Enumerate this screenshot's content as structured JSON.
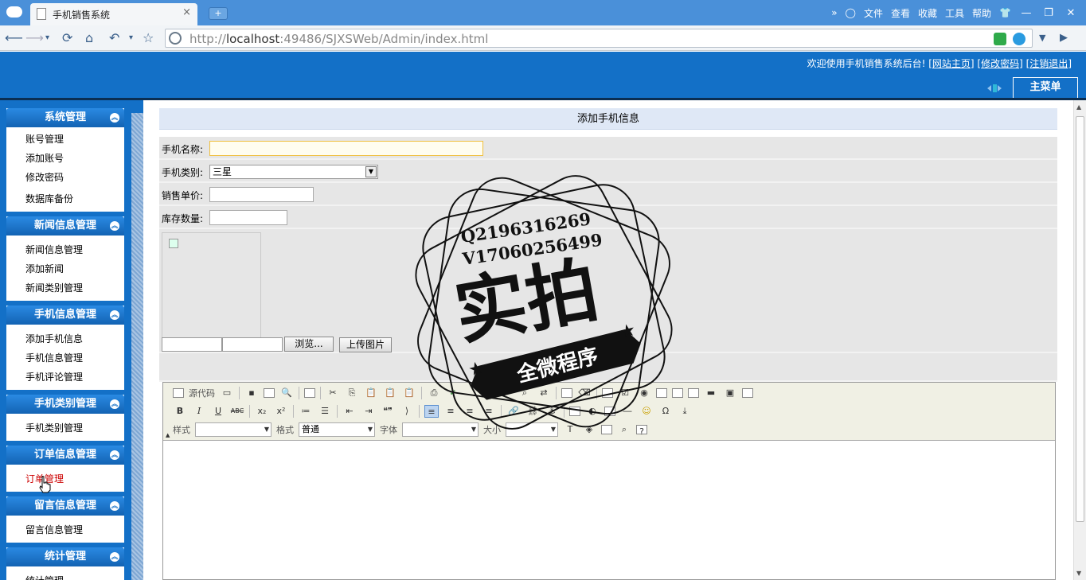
{
  "browser": {
    "tab_title": "手机销售系统",
    "tab_close": "×",
    "new_tab": "+",
    "menu": [
      "»",
      "文件",
      "查看",
      "收藏",
      "工具",
      "帮助"
    ],
    "window_buttons": [
      "—",
      "❐",
      "✕"
    ],
    "url_host": "http://",
    "url_bold": "localhost",
    "url_rest": ":49486/SJXSWeb/Admin/index.html"
  },
  "header": {
    "welcome": "欢迎使用手机销售系统后台!",
    "links": [
      "网站主页",
      "修改密码",
      "注销退出"
    ],
    "main_menu": "主菜单"
  },
  "sidebar": {
    "groups": [
      {
        "title": "系统管理",
        "items": [
          "账号管理",
          "添加账号",
          "修改密码",
          "数据库备份"
        ]
      },
      {
        "title": "新闻信息管理",
        "items": [
          "新闻信息管理",
          "添加新闻",
          "新闻类别管理"
        ]
      },
      {
        "title": "手机信息管理",
        "items": [
          "添加手机信息",
          "手机信息管理",
          "手机评论管理"
        ]
      },
      {
        "title": "手机类别管理",
        "items": [
          "手机类别管理"
        ]
      },
      {
        "title": "订单信息管理",
        "items": [
          "订单管理"
        ]
      },
      {
        "title": "留言信息管理",
        "items": [
          "留言信息管理"
        ]
      },
      {
        "title": "统计管理",
        "items": [
          "统计管理"
        ]
      }
    ]
  },
  "form": {
    "title": "添加手机信息",
    "name_label": "手机名称:",
    "name_value": "",
    "category_label": "手机类别:",
    "category_value": "三星",
    "price_label": "销售单价:",
    "price_value": "",
    "stock_label": "库存数量:",
    "stock_value": "",
    "browse_button": "浏览...",
    "upload_button": "上传图片"
  },
  "editor": {
    "row1_source": "源代码",
    "style_label": "样式",
    "format_label": "格式",
    "format_value": "普通",
    "font_label": "字体",
    "size_label": "大小",
    "bold": "B",
    "italic": "I",
    "underline": "U",
    "strike": "ABC",
    "subscript": "x₂",
    "superscript": "x²",
    "quote": "❝❞",
    "help": "?"
  },
  "watermark": {
    "line1": "Q2196316269",
    "line2": "V17060256499",
    "main": "实拍",
    "banner": "全微程序"
  },
  "colors": {
    "accent": "#1370c7",
    "browser_blue": "#4a90d9",
    "form_title_bg": "#dfe8f6",
    "active_item": "#cc0000"
  }
}
